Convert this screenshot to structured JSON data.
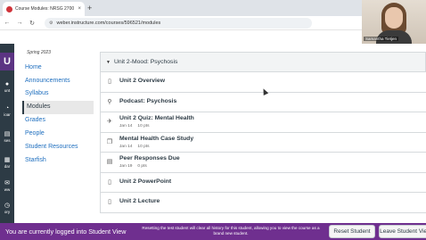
{
  "browser": {
    "tab_title": "Course Modules: NRSG 2700 Di",
    "tab_close": "×",
    "new_tab": "+",
    "url": "weber.instructure.com/courses/596521/modules"
  },
  "webcam": {
    "name": "Samantha Tietjen"
  },
  "global_nav": {
    "logo": "U",
    "items": [
      {
        "label": "unt",
        "icon": "account-icon"
      },
      {
        "label": "ioar",
        "icon": "dashboard-icon"
      },
      {
        "label": "ses",
        "icon": "courses-icon"
      },
      {
        "label": "dar",
        "icon": "calendar-icon"
      },
      {
        "label": "ww",
        "icon": "inbox-icon"
      },
      {
        "label": "ory",
        "icon": "history-icon"
      }
    ]
  },
  "course_nav": {
    "term": "Spring 2023",
    "links": [
      "Home",
      "Announcements",
      "Syllabus",
      "Modules",
      "Grades",
      "People",
      "Student Resources",
      "Starfish"
    ],
    "active": "Modules"
  },
  "module": {
    "title": "Unit 2-Mood: Psychosis",
    "items": [
      {
        "title": "Unit 2 Overview",
        "icon": "page-icon",
        "date": "",
        "points": ""
      },
      {
        "title": "Podcast: Psychosis",
        "icon": "link-icon",
        "date": "",
        "points": ""
      },
      {
        "title": "Unit 2 Quiz: Mental Health",
        "icon": "quiz-icon",
        "date": "Jan 14",
        "points": "10 pts"
      },
      {
        "title": "Mental Health Case Study",
        "icon": "discussion-icon",
        "date": "Jan 14",
        "points": "10 pts"
      },
      {
        "title": "Peer Responses Due",
        "icon": "assignment-icon",
        "date": "Jan 19",
        "points": "0 pts"
      },
      {
        "title": "Unit 2 PowerPoint",
        "icon": "page-icon",
        "date": "",
        "points": ""
      },
      {
        "title": "Unit 2 Lecture",
        "icon": "page-icon",
        "date": "",
        "points": ""
      }
    ]
  },
  "student_view": {
    "message": "You are currently logged into Student View",
    "note": "Resetting the test student will clear all history for this student, allowing you to view the course as a brand new student.",
    "reset_label": "Reset Student",
    "leave_label": "Leave Student View"
  },
  "colors": {
    "accent": "#6f2f8f",
    "nav_dark": "#2d3b45",
    "link": "#1f6fbf"
  }
}
